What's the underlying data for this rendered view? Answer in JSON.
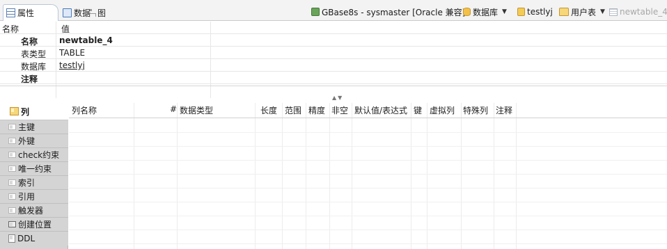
{
  "tabs": {
    "properties": "属性",
    "data": "数据",
    "diagram": "图"
  },
  "breadcrumb": {
    "connection": "GBase8s - sysmaster [Oracle 兼容]",
    "database": "数据库",
    "schema": "testlyj",
    "folder": "用户表",
    "table": "newtable_4"
  },
  "properties": {
    "header_name": "名称",
    "header_value": "值",
    "rows": [
      {
        "key": "名称",
        "value": "newtable_4"
      },
      {
        "key": "表类型",
        "value": "TABLE"
      },
      {
        "key": "数据库",
        "value": "testlyj"
      },
      {
        "key": "注释",
        "value": ""
      }
    ]
  },
  "nav": {
    "items": [
      "列",
      "主键",
      "外键",
      "check约束",
      "唯一约束",
      "索引",
      "引用",
      "触发器",
      "创建位置",
      "DDL"
    ]
  },
  "columns": {
    "headers": [
      "列名称",
      "#",
      "数据类型",
      "长度",
      "范围",
      "精度",
      "非空",
      "默认值/表达式",
      "键",
      "虚拟列",
      "特殊列",
      "注释"
    ]
  },
  "colors": {
    "nav_bg": "#d4d4d4",
    "link": "#1a3aa8"
  }
}
